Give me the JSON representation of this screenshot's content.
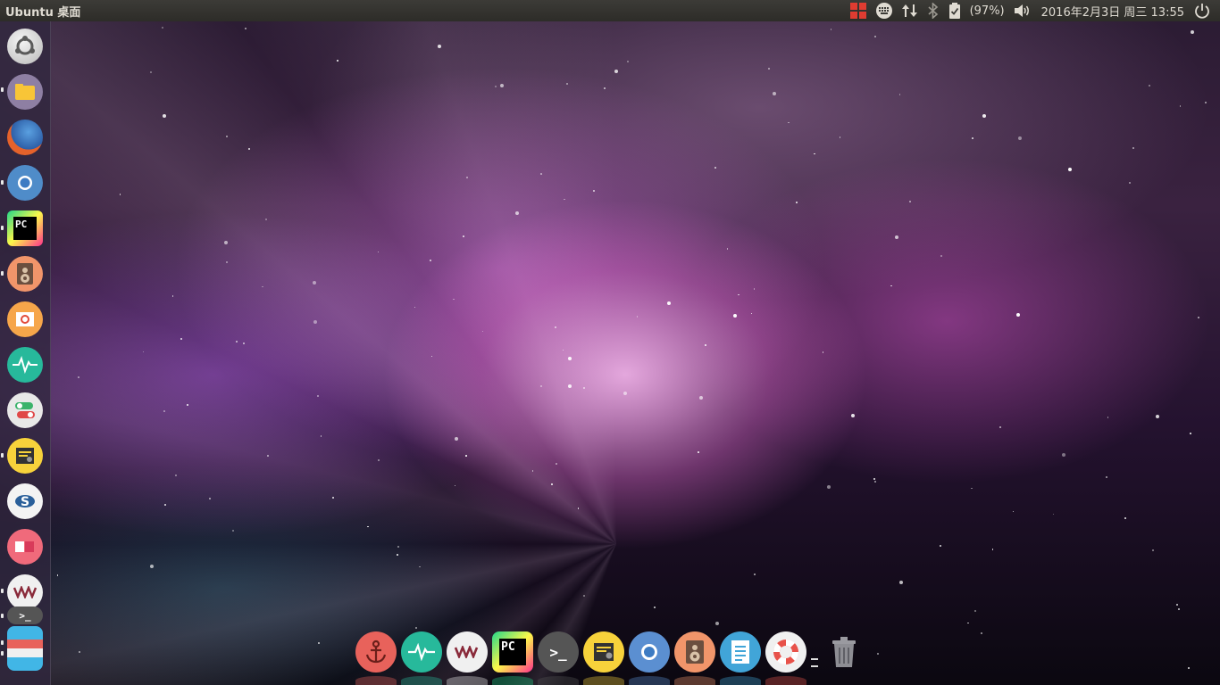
{
  "top_panel": {
    "title": "Ubuntu 桌面",
    "battery_text": "(97%)",
    "clock": "2016年2月3日 周三 13:55",
    "indicators": [
      "grid-indicator-icon",
      "keyboard-icon",
      "network-transfer-icon",
      "bluetooth-icon",
      "battery-icon",
      "volume-icon",
      "power-icon"
    ],
    "colors": {
      "panel_bg": "#3c3b37",
      "text": "#dfdbd2",
      "grid_red": "#e03c31"
    }
  },
  "launcher": {
    "items": [
      {
        "name": "ubuntu-dash-icon",
        "color": "#dcdcdc"
      },
      {
        "name": "files-folder-icon",
        "color": "#8e7fa3"
      },
      {
        "name": "firefox-icon",
        "color": "#e5622b"
      },
      {
        "name": "chromium-icon",
        "color": "#4f8cc9"
      },
      {
        "name": "pycharm-icon",
        "color": "#21d789"
      },
      {
        "name": "speaker-app-icon",
        "color": "#f1956a"
      },
      {
        "name": "screenshot-app-icon",
        "color": "#f6a64a"
      },
      {
        "name": "system-monitor-icon",
        "color": "#27b99b"
      },
      {
        "name": "toggle-settings-icon",
        "color": "#e8e8e8"
      },
      {
        "name": "password-manager-icon",
        "color": "#f7d23b"
      },
      {
        "name": "skype-style-s-icon",
        "color": "#f3f3f3"
      },
      {
        "name": "reader-app-icon",
        "color": "#f06a7b"
      },
      {
        "name": "vm-app-icon",
        "color": "#f0f0f0"
      },
      {
        "name": "terminal-icon",
        "color": "#5a5a5a"
      },
      {
        "name": "stacked-apps-icon",
        "color": "#41b6e6"
      }
    ]
  },
  "dock": {
    "items": [
      {
        "name": "anchor-app-icon",
        "color": "#e8625b",
        "glyph": "⚓"
      },
      {
        "name": "system-monitor-icon",
        "color": "#27b99b",
        "glyph": "∿"
      },
      {
        "name": "vm-app-icon",
        "color": "#f0f0f0",
        "glyph": "VM"
      },
      {
        "name": "pycharm-icon",
        "color": "#21d789",
        "glyph": "PC"
      },
      {
        "name": "terminal-icon",
        "color": "#555555",
        "glyph": ">_"
      },
      {
        "name": "password-manager-icon",
        "color": "#f7d23b",
        "glyph": "▤"
      },
      {
        "name": "chromium-icon",
        "color": "#5b8fd1",
        "glyph": "◯"
      },
      {
        "name": "speaker-app-icon",
        "color": "#f1956a",
        "glyph": "◎"
      },
      {
        "name": "text-editor-icon",
        "color": "#41a5d8",
        "glyph": "≣"
      },
      {
        "name": "help-lifebuoy-icon",
        "color": "#f0f0f0",
        "glyph": "◉"
      }
    ],
    "trash": {
      "name": "trash-icon",
      "color": "#8e8e94"
    }
  }
}
